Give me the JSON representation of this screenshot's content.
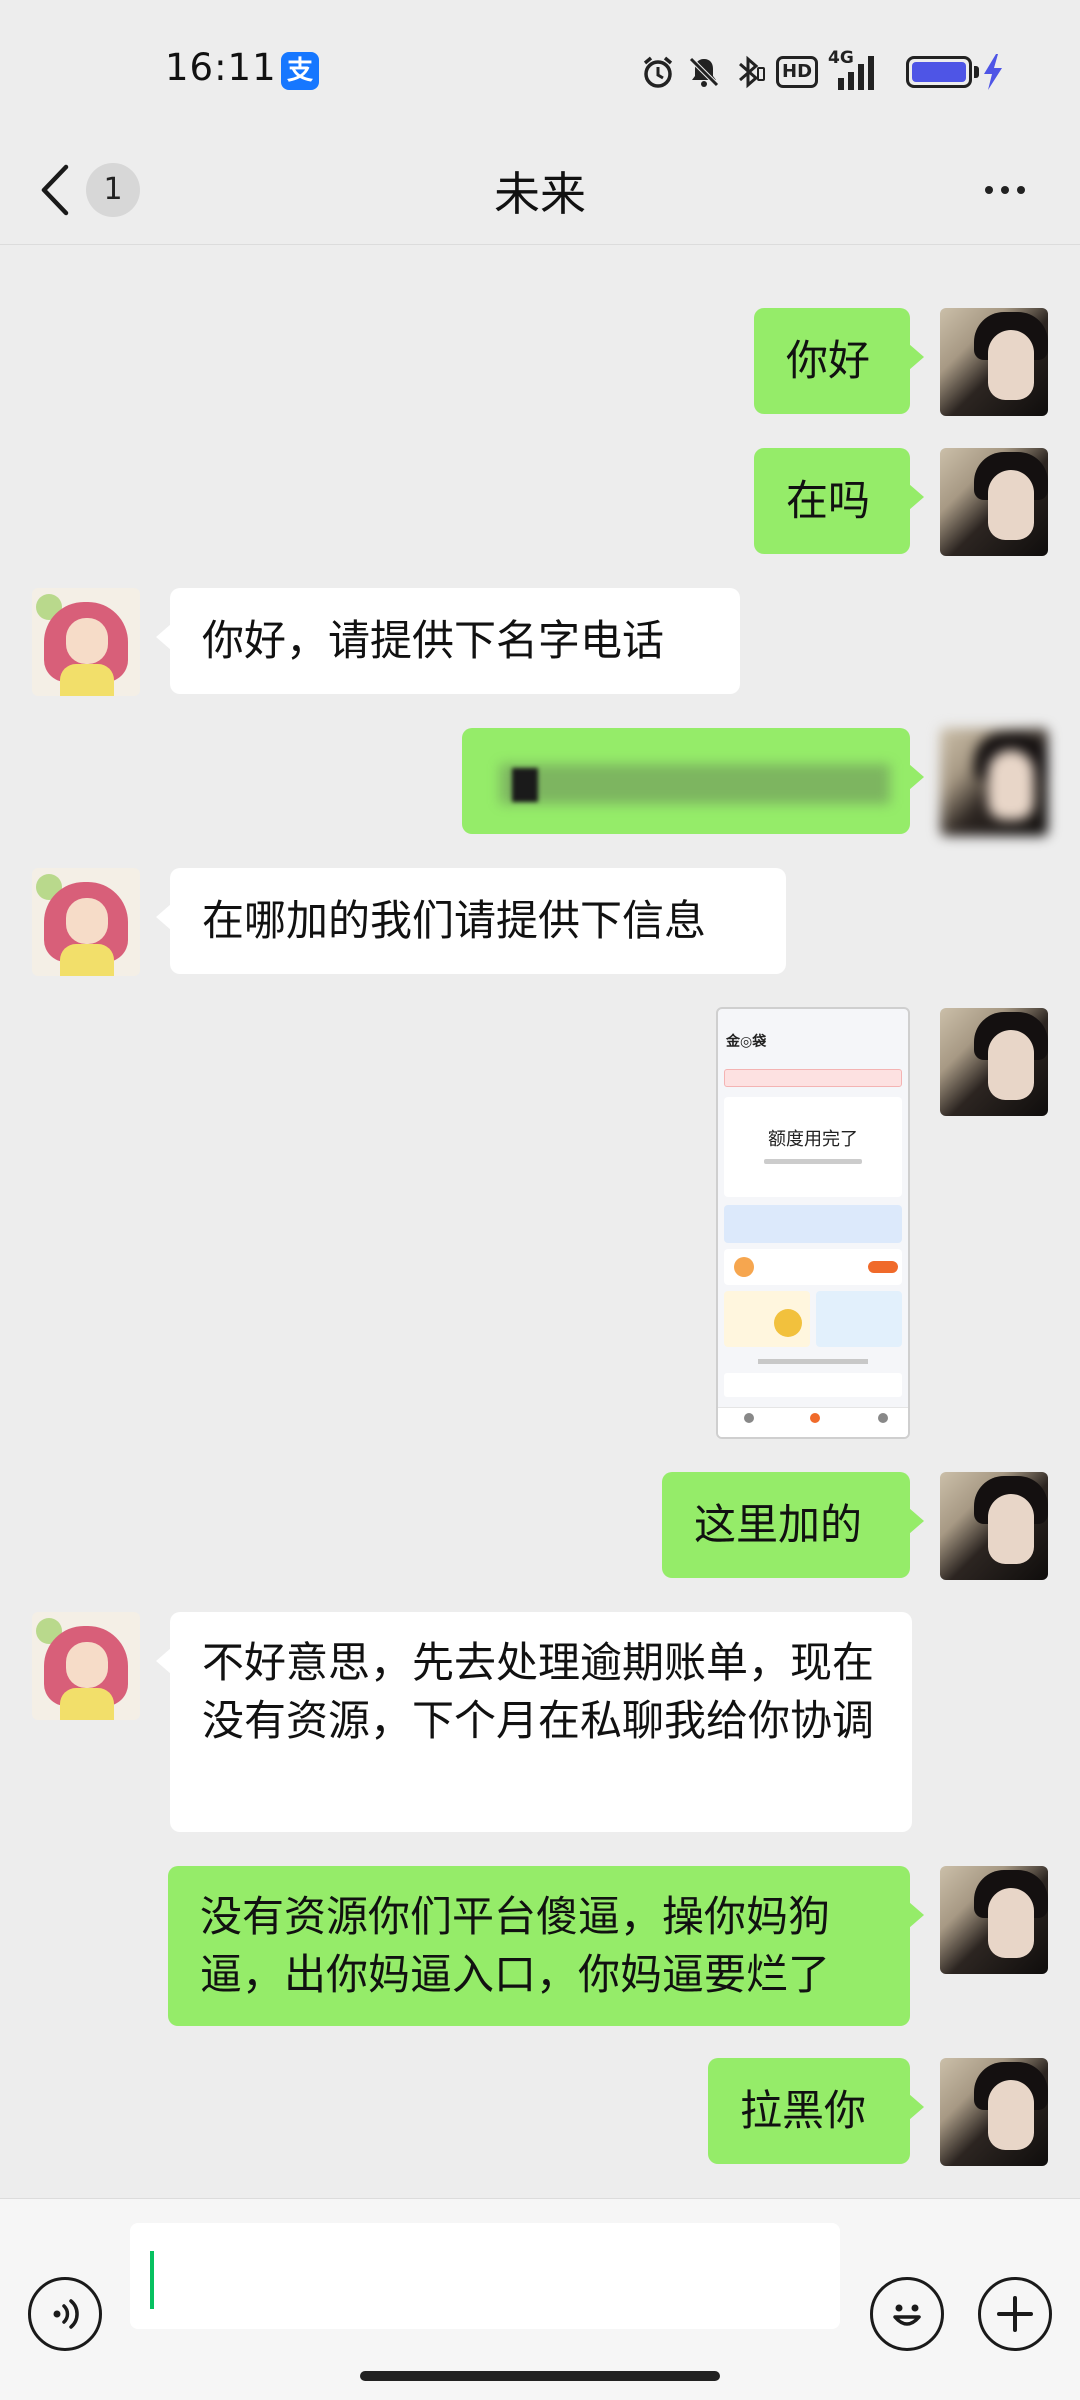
{
  "status_bar": {
    "time": "16:11",
    "app_icon": "alipay-icon",
    "icons": [
      "alarm-icon",
      "mute-icon",
      "bluetooth-icon",
      "hd-icon",
      "signal-4g-icon",
      "battery-icon",
      "charging-icon"
    ],
    "hd_label": "HD",
    "network_label": "4G",
    "battery_color": "#4e55e6"
  },
  "header": {
    "back_icon": "chevron-left-icon",
    "unread_count": "1",
    "title": "未来",
    "more_icon": "more-dots-icon"
  },
  "messages": [
    {
      "from": "me",
      "text": "你好"
    },
    {
      "from": "me",
      "text": "在吗"
    },
    {
      "from": "other",
      "text": "你好，请提供下名字电话"
    },
    {
      "from": "me",
      "text": "",
      "note": "redacted"
    },
    {
      "from": "other",
      "text": "在哪加的我们请提供下信息"
    },
    {
      "from": "me",
      "type": "image",
      "preview": {
        "card_title": "额度用完了"
      }
    },
    {
      "from": "me",
      "text": "这里加的"
    },
    {
      "from": "other",
      "text": "不好意思，先去处理逾期账单，现在没有资源，下个月在私聊我给你协调"
    },
    {
      "from": "me",
      "text": "没有资源你们平台傻逼，操你妈狗逼，出你妈逼入口，你妈逼要烂了"
    },
    {
      "from": "me",
      "text": "拉黑你"
    }
  ],
  "input_bar": {
    "voice_icon": "voice-icon",
    "input_value": "",
    "emoji_icon": "emoji-icon",
    "plus_icon": "plus-icon"
  },
  "colors": {
    "background": "#ededed",
    "bubble_me": "#95ec69",
    "bubble_other": "#ffffff",
    "caret": "#07c160"
  }
}
